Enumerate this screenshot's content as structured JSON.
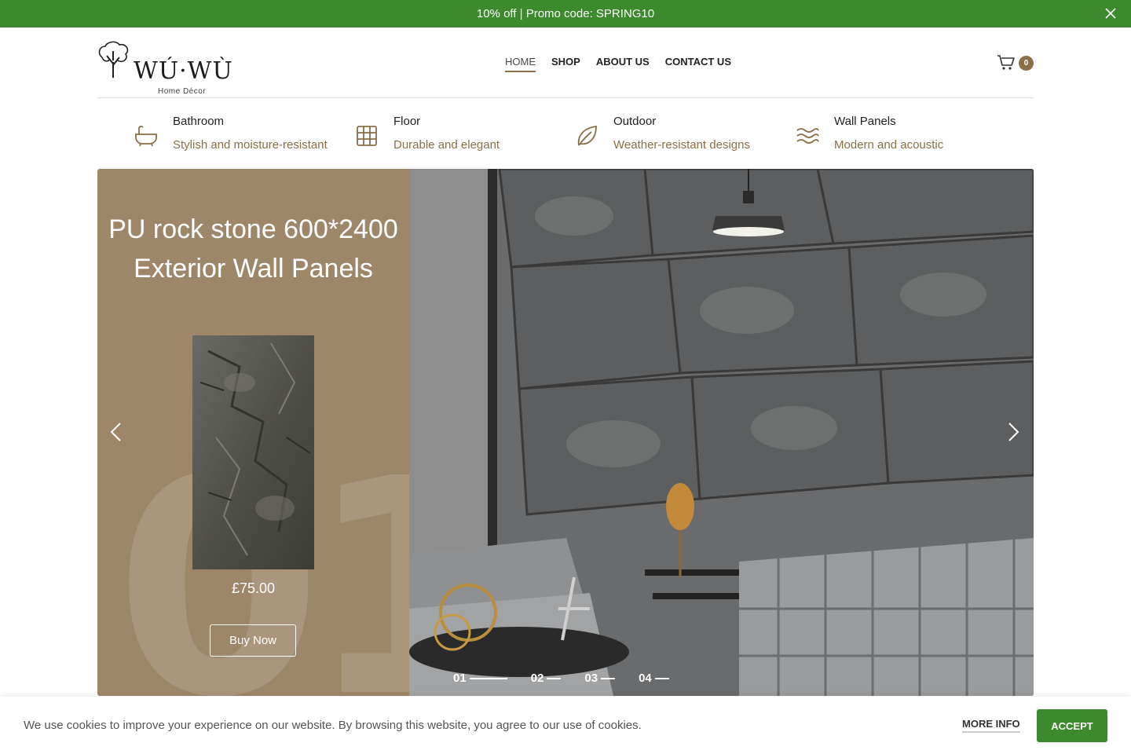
{
  "promo": {
    "text": "10% off | Promo code: SPRING10"
  },
  "brand": {
    "name": "WÚ·WÙ",
    "tagline": "Home Décor"
  },
  "nav": {
    "items": [
      {
        "label": "HOME",
        "active": true
      },
      {
        "label": "SHOP",
        "active": false
      },
      {
        "label": "ABOUT US",
        "active": false
      },
      {
        "label": "CONTACT US",
        "active": false
      }
    ]
  },
  "cart": {
    "count": "0"
  },
  "categories": [
    {
      "title": "Bathroom",
      "desc": "Stylish and moisture-resistant",
      "icon": "bathtub-icon"
    },
    {
      "title": "Floor",
      "desc": "Durable and elegant",
      "icon": "grid-icon"
    },
    {
      "title": "Outdoor",
      "desc": "Weather-resistant designs",
      "icon": "leaf-icon"
    },
    {
      "title": "Wall Panels",
      "desc": "Modern and acoustic",
      "icon": "waves-icon"
    }
  ],
  "slider": {
    "number": "01",
    "title": "PU rock stone 600*2400 Exterior Wall Panels",
    "price": "£75.00",
    "button": "Buy Now",
    "pager": [
      "01",
      "02",
      "03",
      "04"
    ],
    "active_index": 0
  },
  "cookie": {
    "text": "We use cookies to improve your experience on our website. By browsing this website, you agree to our use of cookies.",
    "more_info": "MORE INFO",
    "accept": "ACCEPT"
  },
  "colors": {
    "green": "#3d8a2e",
    "brown": "#8a6f48",
    "panel": "#9e8769"
  }
}
